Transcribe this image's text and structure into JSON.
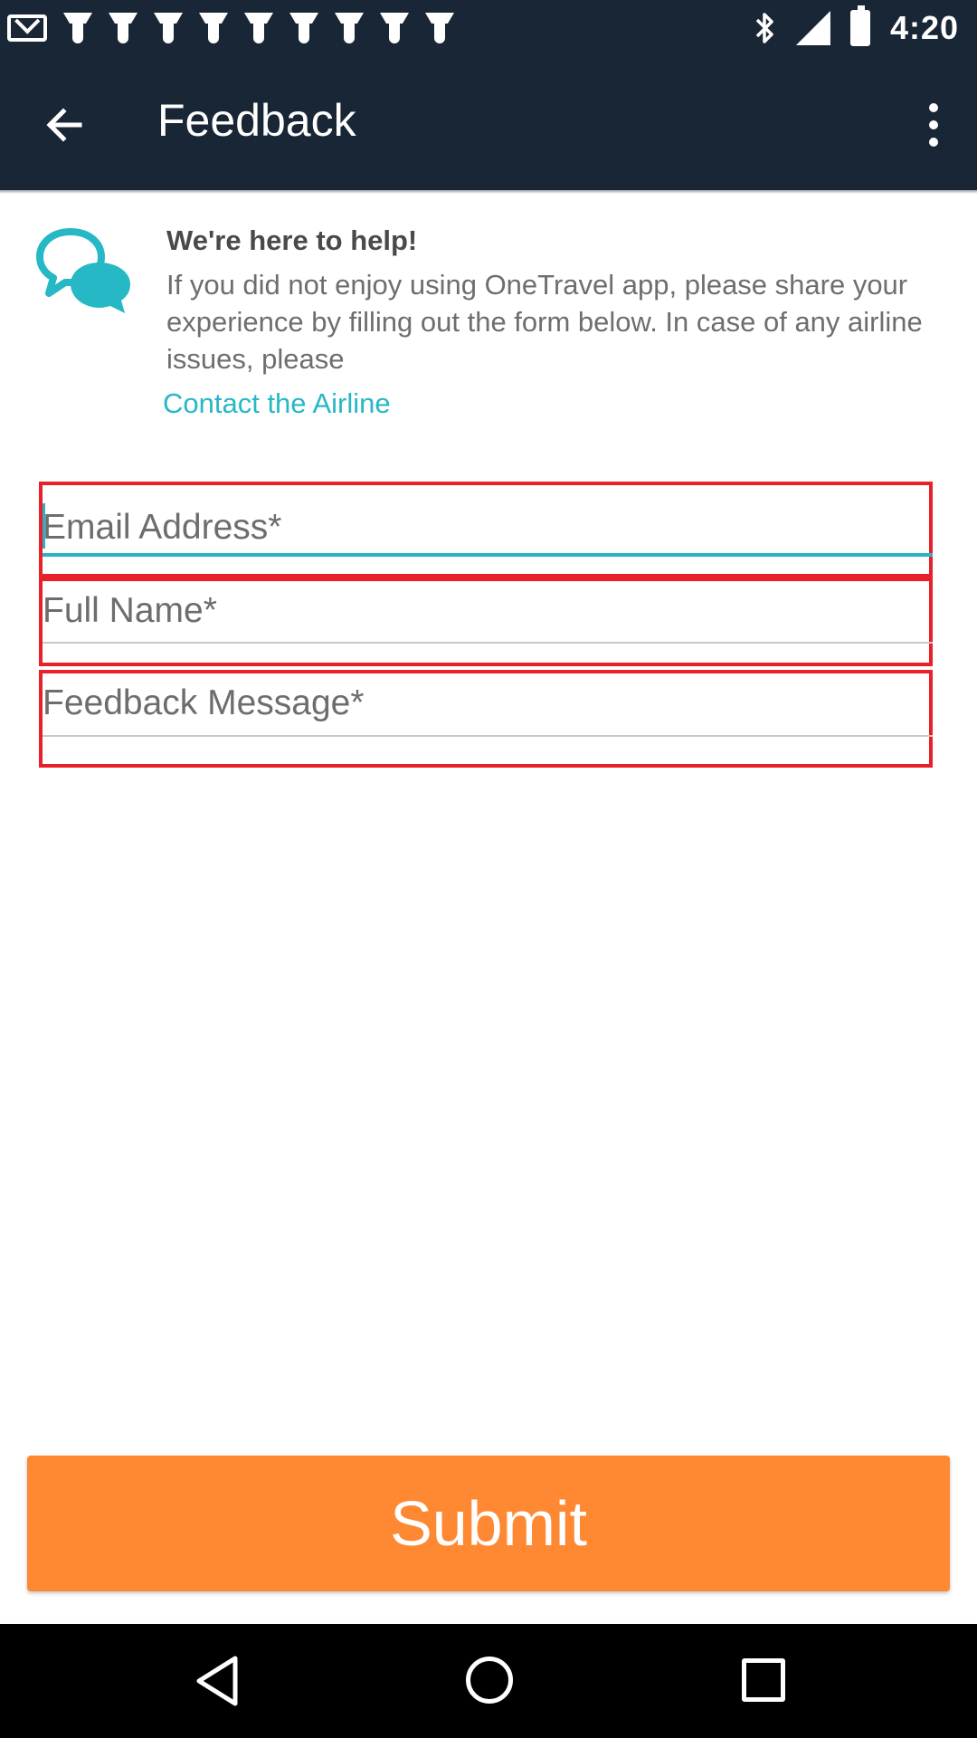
{
  "status_bar": {
    "time": "4:20",
    "notification_icons": [
      "mail-icon",
      "fan-icon",
      "fan-icon",
      "fan-icon",
      "fan-icon",
      "fan-icon",
      "fan-icon",
      "fan-icon",
      "fan-icon",
      "fan-icon"
    ],
    "system_icons": [
      "bluetooth-icon",
      "signal-icon",
      "battery-icon"
    ]
  },
  "app_bar": {
    "title": "Feedback",
    "back_icon": "arrow-back-icon",
    "menu_icon": "more-vert-icon"
  },
  "help": {
    "icon": "chat-bubbles-icon",
    "title": "We're here to help!",
    "body": "If you did not enjoy using OneTravel app, please share your experience by filling out the form below. In case of any airline issues, please",
    "contact_link": "Contact the Airline"
  },
  "form": {
    "email": {
      "placeholder": "Email Address*",
      "value": ""
    },
    "full_name": {
      "placeholder": "Full Name*",
      "value": ""
    },
    "feedback_message": {
      "placeholder": "Feedback Message*",
      "value": ""
    }
  },
  "submit_label": "Submit",
  "colors": {
    "app_bar": "#192635",
    "accent": "#26b8c4",
    "submit": "#fe8932",
    "highlight_border": "#e8202a"
  },
  "nav_bar": {
    "icons": [
      "back-triangle-icon",
      "home-circle-icon",
      "recents-square-icon"
    ]
  }
}
